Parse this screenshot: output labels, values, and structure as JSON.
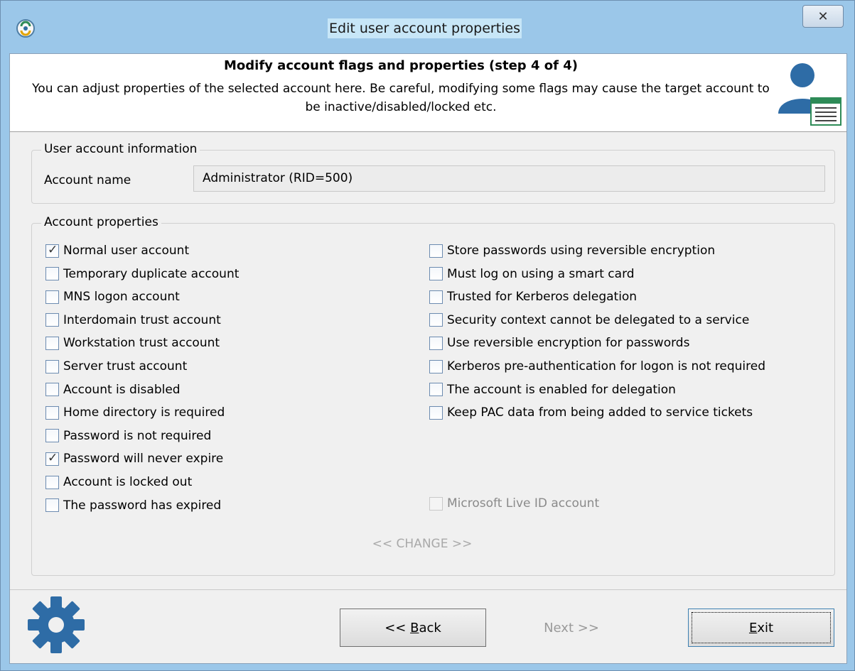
{
  "window": {
    "title": "Edit user account properties",
    "close_glyph": "✕"
  },
  "header": {
    "title": "Modify account flags and properties (step 4 of 4)",
    "description": "You can adjust properties of the selected account here. Be careful, modifying some flags may cause the target account to be inactive/disabled/locked etc.",
    "icon": "user-account-icon"
  },
  "account_info": {
    "group_label": "User account information",
    "account_name_label": "Account name",
    "account_name_value": "Administrator (RID=500)"
  },
  "properties": {
    "group_label": "Account properties",
    "left": [
      {
        "label": "Normal user account",
        "checked": true
      },
      {
        "label": "Temporary duplicate account",
        "checked": false
      },
      {
        "label": "MNS logon account",
        "checked": false
      },
      {
        "label": "Interdomain trust account",
        "checked": false
      },
      {
        "label": "Workstation trust account",
        "checked": false
      },
      {
        "label": "Server trust account",
        "checked": false
      },
      {
        "label": "Account is disabled",
        "checked": false
      },
      {
        "label": "Home directory is required",
        "checked": false
      },
      {
        "label": "Password is not required",
        "checked": false
      },
      {
        "label": "Password will never expire",
        "checked": true
      },
      {
        "label": "Account is locked out",
        "checked": false
      },
      {
        "label": "The password has expired",
        "checked": false
      }
    ],
    "right": [
      {
        "label": "Store passwords using reversible encryption",
        "checked": false
      },
      {
        "label": "Must log on using a smart card",
        "checked": false
      },
      {
        "label": "Trusted for Kerberos delegation",
        "checked": false
      },
      {
        "label": "Security context cannot be delegated to a service",
        "checked": false
      },
      {
        "label": "Use reversible encryption for passwords",
        "checked": false
      },
      {
        "label": "Kerberos pre-authentication for logon is not required",
        "checked": false
      },
      {
        "label": "The account is enabled for delegation",
        "checked": false
      },
      {
        "label": "Keep PAC data from being added to service tickets",
        "checked": false
      }
    ],
    "live_id": {
      "label": "Microsoft Live ID account",
      "checked": false,
      "disabled": true
    },
    "change_label": "<< CHANGE >>"
  },
  "footer": {
    "back_prefix": "<< ",
    "back_access_key": "B",
    "back_rest": "ack",
    "next_label": "Next >>",
    "exit_access_key": "E",
    "exit_rest": "xit"
  }
}
